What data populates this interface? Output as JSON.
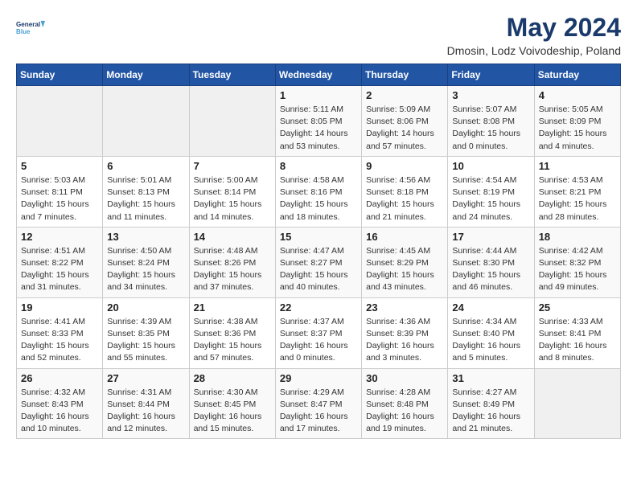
{
  "header": {
    "logo_line1": "General",
    "logo_line2": "Blue",
    "title": "May 2024",
    "subtitle": "Dmosin, Lodz Voivodeship, Poland"
  },
  "weekdays": [
    "Sunday",
    "Monday",
    "Tuesday",
    "Wednesday",
    "Thursday",
    "Friday",
    "Saturday"
  ],
  "weeks": [
    [
      {
        "day": "",
        "info": ""
      },
      {
        "day": "",
        "info": ""
      },
      {
        "day": "",
        "info": ""
      },
      {
        "day": "1",
        "info": "Sunrise: 5:11 AM\nSunset: 8:05 PM\nDaylight: 14 hours\nand 53 minutes."
      },
      {
        "day": "2",
        "info": "Sunrise: 5:09 AM\nSunset: 8:06 PM\nDaylight: 14 hours\nand 57 minutes."
      },
      {
        "day": "3",
        "info": "Sunrise: 5:07 AM\nSunset: 8:08 PM\nDaylight: 15 hours\nand 0 minutes."
      },
      {
        "day": "4",
        "info": "Sunrise: 5:05 AM\nSunset: 8:09 PM\nDaylight: 15 hours\nand 4 minutes."
      }
    ],
    [
      {
        "day": "5",
        "info": "Sunrise: 5:03 AM\nSunset: 8:11 PM\nDaylight: 15 hours\nand 7 minutes."
      },
      {
        "day": "6",
        "info": "Sunrise: 5:01 AM\nSunset: 8:13 PM\nDaylight: 15 hours\nand 11 minutes."
      },
      {
        "day": "7",
        "info": "Sunrise: 5:00 AM\nSunset: 8:14 PM\nDaylight: 15 hours\nand 14 minutes."
      },
      {
        "day": "8",
        "info": "Sunrise: 4:58 AM\nSunset: 8:16 PM\nDaylight: 15 hours\nand 18 minutes."
      },
      {
        "day": "9",
        "info": "Sunrise: 4:56 AM\nSunset: 8:18 PM\nDaylight: 15 hours\nand 21 minutes."
      },
      {
        "day": "10",
        "info": "Sunrise: 4:54 AM\nSunset: 8:19 PM\nDaylight: 15 hours\nand 24 minutes."
      },
      {
        "day": "11",
        "info": "Sunrise: 4:53 AM\nSunset: 8:21 PM\nDaylight: 15 hours\nand 28 minutes."
      }
    ],
    [
      {
        "day": "12",
        "info": "Sunrise: 4:51 AM\nSunset: 8:22 PM\nDaylight: 15 hours\nand 31 minutes."
      },
      {
        "day": "13",
        "info": "Sunrise: 4:50 AM\nSunset: 8:24 PM\nDaylight: 15 hours\nand 34 minutes."
      },
      {
        "day": "14",
        "info": "Sunrise: 4:48 AM\nSunset: 8:26 PM\nDaylight: 15 hours\nand 37 minutes."
      },
      {
        "day": "15",
        "info": "Sunrise: 4:47 AM\nSunset: 8:27 PM\nDaylight: 15 hours\nand 40 minutes."
      },
      {
        "day": "16",
        "info": "Sunrise: 4:45 AM\nSunset: 8:29 PM\nDaylight: 15 hours\nand 43 minutes."
      },
      {
        "day": "17",
        "info": "Sunrise: 4:44 AM\nSunset: 8:30 PM\nDaylight: 15 hours\nand 46 minutes."
      },
      {
        "day": "18",
        "info": "Sunrise: 4:42 AM\nSunset: 8:32 PM\nDaylight: 15 hours\nand 49 minutes."
      }
    ],
    [
      {
        "day": "19",
        "info": "Sunrise: 4:41 AM\nSunset: 8:33 PM\nDaylight: 15 hours\nand 52 minutes."
      },
      {
        "day": "20",
        "info": "Sunrise: 4:39 AM\nSunset: 8:35 PM\nDaylight: 15 hours\nand 55 minutes."
      },
      {
        "day": "21",
        "info": "Sunrise: 4:38 AM\nSunset: 8:36 PM\nDaylight: 15 hours\nand 57 minutes."
      },
      {
        "day": "22",
        "info": "Sunrise: 4:37 AM\nSunset: 8:37 PM\nDaylight: 16 hours\nand 0 minutes."
      },
      {
        "day": "23",
        "info": "Sunrise: 4:36 AM\nSunset: 8:39 PM\nDaylight: 16 hours\nand 3 minutes."
      },
      {
        "day": "24",
        "info": "Sunrise: 4:34 AM\nSunset: 8:40 PM\nDaylight: 16 hours\nand 5 minutes."
      },
      {
        "day": "25",
        "info": "Sunrise: 4:33 AM\nSunset: 8:41 PM\nDaylight: 16 hours\nand 8 minutes."
      }
    ],
    [
      {
        "day": "26",
        "info": "Sunrise: 4:32 AM\nSunset: 8:43 PM\nDaylight: 16 hours\nand 10 minutes."
      },
      {
        "day": "27",
        "info": "Sunrise: 4:31 AM\nSunset: 8:44 PM\nDaylight: 16 hours\nand 12 minutes."
      },
      {
        "day": "28",
        "info": "Sunrise: 4:30 AM\nSunset: 8:45 PM\nDaylight: 16 hours\nand 15 minutes."
      },
      {
        "day": "29",
        "info": "Sunrise: 4:29 AM\nSunset: 8:47 PM\nDaylight: 16 hours\nand 17 minutes."
      },
      {
        "day": "30",
        "info": "Sunrise: 4:28 AM\nSunset: 8:48 PM\nDaylight: 16 hours\nand 19 minutes."
      },
      {
        "day": "31",
        "info": "Sunrise: 4:27 AM\nSunset: 8:49 PM\nDaylight: 16 hours\nand 21 minutes."
      },
      {
        "day": "",
        "info": ""
      }
    ]
  ]
}
